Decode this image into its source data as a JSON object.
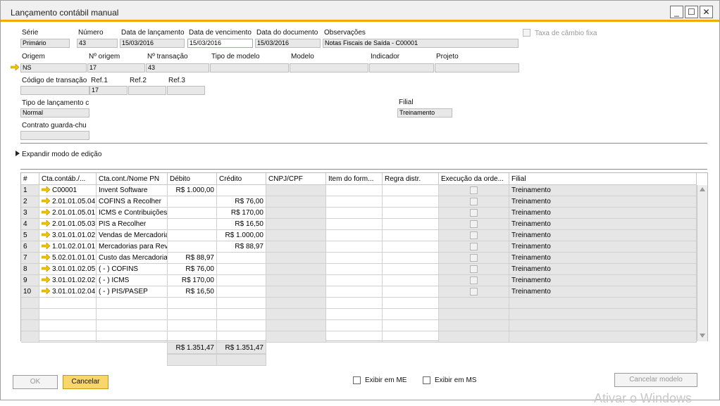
{
  "window": {
    "title": "Lançamento contábil manual",
    "minimize": "_",
    "maximize": "☐",
    "close": "✕"
  },
  "header": {
    "serie": {
      "label": "Série",
      "value": "Primário"
    },
    "numero": {
      "label": "Número",
      "value": "43"
    },
    "data_lancamento": {
      "label": "Data de lançamento",
      "value": "15/03/2016"
    },
    "data_vencimento": {
      "label": "Data de vencimento",
      "value": "15/03/2016"
    },
    "data_documento": {
      "label": "Data do documento",
      "value": "15/03/2016"
    },
    "observacoes": {
      "label": "Observações",
      "value": "Notas Fiscais de Saída - C00001"
    },
    "taxa_cambio": {
      "label": "Taxa de câmbio fixa"
    },
    "origem": {
      "label": "Origem",
      "value": "NS"
    },
    "n_origem": {
      "label": "Nº origem",
      "value": "17"
    },
    "n_transacao": {
      "label": "Nº transação",
      "value": "43"
    },
    "tipo_modelo": {
      "label": "Tipo de modelo",
      "value": ""
    },
    "modelo": {
      "label": "Modelo",
      "value": ""
    },
    "indicador": {
      "label": "Indicador",
      "value": ""
    },
    "projeto": {
      "label": "Projeto",
      "value": ""
    },
    "codigo_transacao": {
      "label": "Código de transação",
      "value": ""
    },
    "ref1": {
      "label": "Ref.1",
      "value": "17"
    },
    "ref2": {
      "label": "Ref.2",
      "value": ""
    },
    "ref3": {
      "label": "Ref.3",
      "value": ""
    },
    "tipo_lancamento": {
      "label": "Tipo de lançamento c",
      "value": "Normal"
    },
    "filial": {
      "label": "Filial",
      "value": "Treinamento"
    },
    "contrato": {
      "label": "Contrato guarda-chu",
      "value": ""
    }
  },
  "expand_label": "Expandir modo de edição",
  "grid": {
    "columns": [
      "#",
      "Cta.contáb./...",
      "Cta.cont./Nome PN",
      "Débito",
      "Crédito",
      "CNPJ/CPF",
      "Item do form...",
      "Regra distr.",
      "Execução da orde...",
      "Filial"
    ],
    "rows": [
      {
        "n": "1",
        "conta": "C00001",
        "nome": "Invent Software",
        "debito": "R$ 1.000,00",
        "credito": "",
        "filial": "Treinamento"
      },
      {
        "n": "2",
        "conta": "2.01.01.05.04",
        "nome": "COFINS a Recolher",
        "debito": "",
        "credito": "R$ 76,00",
        "filial": "Treinamento"
      },
      {
        "n": "3",
        "conta": "2.01.01.05.01",
        "nome": "ICMS e Contribuições",
        "debito": "",
        "credito": "R$ 170,00",
        "filial": "Treinamento"
      },
      {
        "n": "4",
        "conta": "2.01.01.05.03",
        "nome": "PIS a Recolher",
        "debito": "",
        "credito": "R$ 16,50",
        "filial": "Treinamento"
      },
      {
        "n": "5",
        "conta": "3.01.01.01.02",
        "nome": "Vendas de Mercadorias",
        "debito": "",
        "credito": "R$ 1.000,00",
        "filial": "Treinamento"
      },
      {
        "n": "6",
        "conta": "1.01.02.01.01",
        "nome": "Mercadorias para Reve",
        "debito": "",
        "credito": "R$ 88,97",
        "filial": "Treinamento"
      },
      {
        "n": "7",
        "conta": "5.02.01.01.01",
        "nome": "Custo das Mercadorias",
        "debito": "R$ 88,97",
        "credito": "",
        "filial": "Treinamento"
      },
      {
        "n": "8",
        "conta": "3.01.01.02.05",
        "nome": "( - ) COFINS",
        "debito": "R$ 76,00",
        "credito": "",
        "filial": "Treinamento"
      },
      {
        "n": "9",
        "conta": "3.01.01.02.02",
        "nome": "( - ) ICMS",
        "debito": "R$ 170,00",
        "credito": "",
        "filial": "Treinamento"
      },
      {
        "n": "10",
        "conta": "3.01.01.02.04",
        "nome": "( - ) PIS/PASEP",
        "debito": "R$ 16,50",
        "credito": "",
        "filial": "Treinamento"
      }
    ],
    "total_debito": "R$ 1.351,47",
    "total_credito": "R$ 1.351,47"
  },
  "footer": {
    "ok": "OK",
    "cancelar": "Cancelar",
    "exibir_me": "Exibir em ME",
    "exibir_ms": "Exibir em MS",
    "cancelar_modelo": "Cancelar modelo"
  },
  "watermark": "Ativar o Windows",
  "colors": {
    "accent": "#f0ab00",
    "arrow": "#f5c400",
    "primary_button": "#f8d66b"
  }
}
